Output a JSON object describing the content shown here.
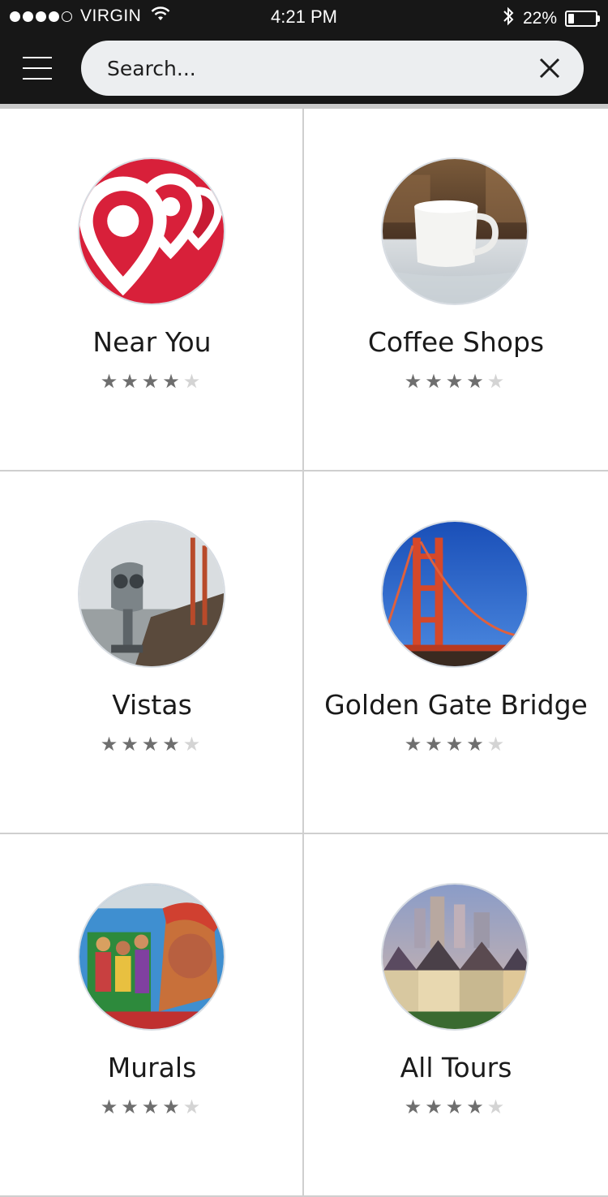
{
  "status_bar": {
    "carrier": "VIRGIN",
    "time": "4:21 PM",
    "battery": "22%",
    "battery_level": 0.22,
    "signal_bars": 4,
    "signal_max": 5
  },
  "search": {
    "placeholder": "Search..."
  },
  "tiles": [
    {
      "title": "Near You",
      "rating": 4,
      "max_rating": 5,
      "image": "map-pins-icon"
    },
    {
      "title": "Coffee Shops",
      "rating": 4,
      "max_rating": 5,
      "image": "coffee-cup-photo"
    },
    {
      "title": "Vistas",
      "rating": 4,
      "max_rating": 5,
      "image": "binoculars-viewer-photo"
    },
    {
      "title": "Golden Gate Bridge",
      "rating": 4,
      "max_rating": 5,
      "image": "golden-gate-bridge-photo"
    },
    {
      "title": "Murals",
      "rating": 4,
      "max_rating": 5,
      "image": "mural-photo"
    },
    {
      "title": "All Tours",
      "rating": 4,
      "max_rating": 5,
      "image": "painted-ladies-photo"
    }
  ],
  "colors": {
    "bar_bg": "#171717",
    "search_bg": "#eceef0",
    "accent_red": "#d8203a",
    "star_on": "#6e6e6e",
    "star_off": "#d4d4d4"
  }
}
